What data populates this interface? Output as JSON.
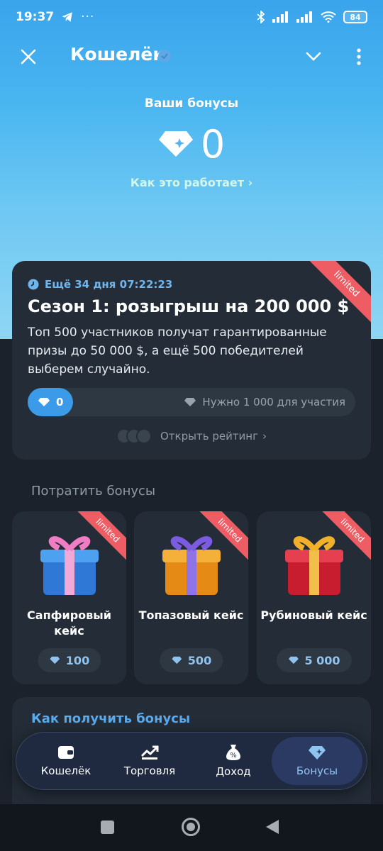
{
  "status_bar": {
    "time": "19:37",
    "dots": "···",
    "battery": "84"
  },
  "header": {
    "title": "Кошелёк"
  },
  "hero": {
    "label": "Ваши бонусы",
    "value": "0",
    "link": "Как это работает"
  },
  "season": {
    "badge": "limited",
    "timer": "Ещё 34 дня 07:22:23",
    "title": "Сезон 1: розыгрыш на 200 000 $",
    "description": "Топ 500 участников получат гарантированные призы до 50 000 $, а ещё 500 победителей выберем случайно.",
    "progress_value": "0",
    "progress_need": "Нужно 1 000 для участия",
    "rating_link": "Открыть рейтинг"
  },
  "spend": {
    "title": "Потратить бонусы",
    "cases": [
      {
        "badge": "limited",
        "name": "Сапфировый кейс",
        "price": "100",
        "color": "#3a8be0"
      },
      {
        "badge": "limited",
        "name": "Топазовый кейс",
        "price": "500",
        "color": "#f0a020"
      },
      {
        "badge": "limited",
        "name": "Рубиновый кейс",
        "price": "5 000",
        "color": "#d0263a"
      }
    ]
  },
  "howget": {
    "title": "Как получить бонусы"
  },
  "tabbar": {
    "tabs": [
      {
        "label": "Кошелёк"
      },
      {
        "label": "Торговля"
      },
      {
        "label": "Доход"
      },
      {
        "label": "Бонусы"
      }
    ]
  },
  "colors": {
    "accent": "#3b9be8",
    "ribbon": "#ee5d63",
    "card": "#232c37"
  }
}
